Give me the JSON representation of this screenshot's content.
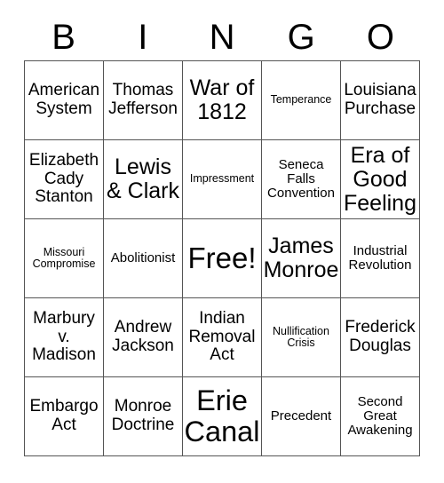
{
  "card": {
    "title": "BINGO",
    "header_letters": [
      "B",
      "I",
      "N",
      "G",
      "O"
    ],
    "border_color": "#555555",
    "background_color": "#ffffff",
    "text_color": "#000000",
    "grid_size": "5x5",
    "free_space": "Free!"
  },
  "grid": {
    "rows": [
      {
        "cells": [
          {
            "text": "American System",
            "size": "s-md",
            "free": false
          },
          {
            "text": "Thomas Jefferson",
            "size": "s-md",
            "free": false
          },
          {
            "text": "War of 1812",
            "size": "s-lg",
            "free": false
          },
          {
            "text": "Temperance",
            "size": "s-xs",
            "free": false
          },
          {
            "text": "Louisiana Purchase",
            "size": "s-md",
            "free": false
          }
        ]
      },
      {
        "cells": [
          {
            "text": "Elizabeth Cady Stanton",
            "size": "s-md",
            "free": false
          },
          {
            "text": "Lewis & Clark",
            "size": "s-lg",
            "free": false
          },
          {
            "text": "Impressment",
            "size": "s-xs",
            "free": false
          },
          {
            "text": "Seneca Falls Convention",
            "size": "s-sm",
            "free": false
          },
          {
            "text": "Era of Good Feeling",
            "size": "s-lg",
            "free": false
          }
        ]
      },
      {
        "cells": [
          {
            "text": "Missouri Compromise",
            "size": "s-xs",
            "free": false
          },
          {
            "text": "Abolitionist",
            "size": "s-sm",
            "free": false
          },
          {
            "text": "Free!",
            "size": "s-xl",
            "free": true
          },
          {
            "text": "James Monroe",
            "size": "s-lg",
            "free": false
          },
          {
            "text": "Industrial Revolution",
            "size": "s-sm",
            "free": false
          }
        ]
      },
      {
        "cells": [
          {
            "text": "Marbury v. Madison",
            "size": "s-md",
            "free": false
          },
          {
            "text": "Andrew Jackson",
            "size": "s-md",
            "free": false
          },
          {
            "text": "Indian Removal Act",
            "size": "s-md",
            "free": false
          },
          {
            "text": "Nullification Crisis",
            "size": "s-xs",
            "free": false
          },
          {
            "text": "Frederick Douglas",
            "size": "s-md",
            "free": false
          }
        ]
      },
      {
        "cells": [
          {
            "text": "Embargo Act",
            "size": "s-md",
            "free": false
          },
          {
            "text": "Monroe Doctrine",
            "size": "s-md",
            "free": false
          },
          {
            "text": "Erie Canal",
            "size": "s-xl",
            "free": false
          },
          {
            "text": "Precedent",
            "size": "s-sm",
            "free": false
          },
          {
            "text": "Second Great Awakening",
            "size": "s-sm",
            "free": false
          }
        ]
      }
    ]
  }
}
